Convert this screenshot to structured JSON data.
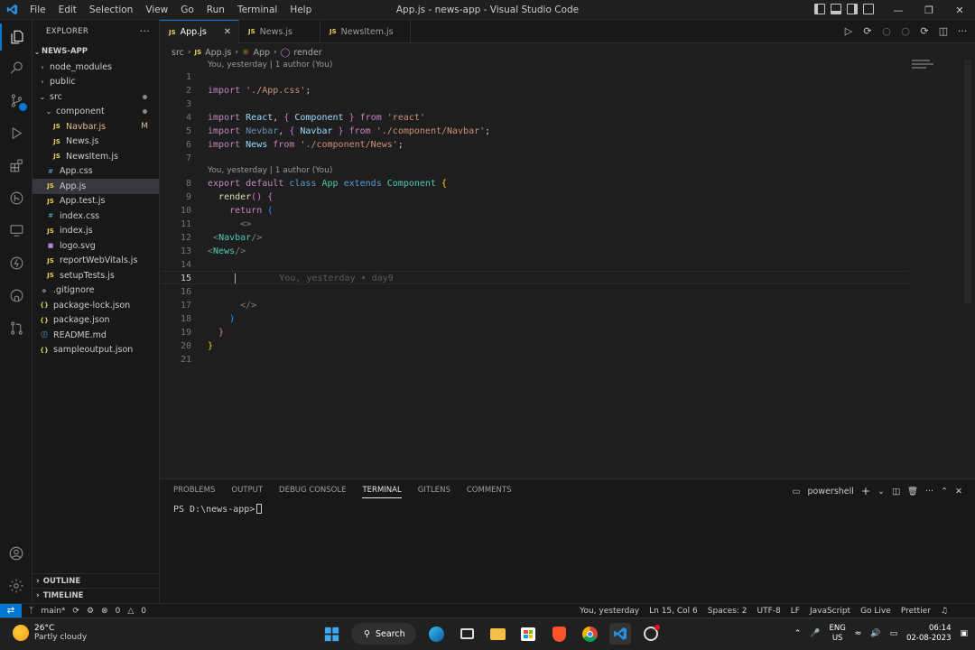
{
  "window": {
    "title": "App.js - news-app - Visual Studio Code",
    "menu": [
      "File",
      "Edit",
      "Selection",
      "View",
      "Go",
      "Run",
      "Terminal",
      "Help"
    ]
  },
  "sidebar": {
    "header": "EXPLORER",
    "root": "NEWS-APP",
    "tree": [
      {
        "label": "node_modules",
        "type": "folder",
        "depth": 0,
        "open": false
      },
      {
        "label": "public",
        "type": "folder",
        "depth": 0,
        "open": false
      },
      {
        "label": "src",
        "type": "folder",
        "depth": 0,
        "open": true,
        "dot": true
      },
      {
        "label": "component",
        "type": "folder",
        "depth": 1,
        "open": true,
        "dot": true
      },
      {
        "label": "Navbar.js",
        "type": "js",
        "depth": 2,
        "badge": "M"
      },
      {
        "label": "News.js",
        "type": "js",
        "depth": 2
      },
      {
        "label": "NewsItem.js",
        "type": "js",
        "depth": 2
      },
      {
        "label": "App.css",
        "type": "css",
        "depth": 1
      },
      {
        "label": "App.js",
        "type": "js",
        "depth": 1,
        "selected": true
      },
      {
        "label": "App.test.js",
        "type": "js",
        "depth": 1
      },
      {
        "label": "index.css",
        "type": "css",
        "depth": 1
      },
      {
        "label": "index.js",
        "type": "js",
        "depth": 1
      },
      {
        "label": "logo.svg",
        "type": "svg",
        "depth": 1
      },
      {
        "label": "reportWebVitals.js",
        "type": "js",
        "depth": 1
      },
      {
        "label": "setupTests.js",
        "type": "js",
        "depth": 1
      },
      {
        "label": ".gitignore",
        "type": "git",
        "depth": 0
      },
      {
        "label": "package-lock.json",
        "type": "json",
        "depth": 0
      },
      {
        "label": "package.json",
        "type": "json",
        "depth": 0
      },
      {
        "label": "README.md",
        "type": "info",
        "depth": 0
      },
      {
        "label": "sampleoutput.json",
        "type": "json",
        "depth": 0
      }
    ],
    "outline": "OUTLINE",
    "timeline": "TIMELINE"
  },
  "tabs": [
    {
      "label": "App.js",
      "active": true
    },
    {
      "label": "News.js",
      "active": false
    },
    {
      "label": "NewsItem.js",
      "active": false
    }
  ],
  "breadcrumb": {
    "folder": "src",
    "file": "App.js",
    "class": "App",
    "method": "render"
  },
  "editor": {
    "codelens_top": "You, yesterday | 1 author (You)",
    "codelens_class": "You, yesterday | 1 author (You)",
    "blame_inline": "You, yesterday • day9",
    "current_line": 15
  },
  "panel": {
    "tabs": [
      "PROBLEMS",
      "OUTPUT",
      "DEBUG CONSOLE",
      "TERMINAL",
      "GITLENS",
      "COMMENTS"
    ],
    "active_tab": "TERMINAL",
    "shell": "powershell",
    "prompt": "PS D:\\news-app>"
  },
  "statusbar": {
    "branch": "main*",
    "errors": "0",
    "warnings": "0",
    "blame": "You, yesterday",
    "position": "Ln 15, Col 6",
    "spaces": "Spaces: 2",
    "encoding": "UTF-8",
    "eol": "LF",
    "language": "JavaScript",
    "golive": "Go Live",
    "prettier": "Prettier"
  },
  "taskbar": {
    "temp": "26°C",
    "weather": "Partly cloudy",
    "search": "Search",
    "lang_top": "ENG",
    "lang_bottom": "US",
    "time": "06:14",
    "date": "02-08-2023"
  },
  "colors": {
    "accent": "#0078d4",
    "editor_bg": "#1f1f1f",
    "sidebar_bg": "#181818"
  }
}
